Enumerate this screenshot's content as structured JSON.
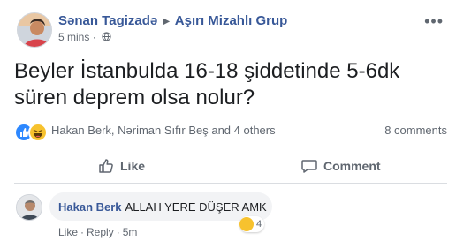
{
  "post": {
    "author": "Sənan Tagizadə",
    "group": "Aşırı Mizahlı Grup",
    "timestamp": "5 mins",
    "separator": "·",
    "text": "Beyler İstanbulda 16-18 şiddetinde 5-6dk süren deprem olsa nolur?",
    "more_icon": "more-horizontal-icon"
  },
  "reactions": {
    "icons": [
      "like-reaction-icon",
      "haha-reaction-icon"
    ],
    "summary": "Hakan Berk, Nəriman Sıfır Beş and 4 others",
    "comment_count": "8 comments"
  },
  "actions": {
    "like_label": "Like",
    "comment_label": "Comment"
  },
  "comment": {
    "author": "Hakan Berk",
    "text": "ALLAH YERE DÜŞER AMK",
    "reaction_count": "4",
    "like_label": "Like",
    "reply_label": "Reply",
    "separator": "·",
    "timestamp": "5m"
  },
  "colors": {
    "link_blue": "#385898",
    "like_blue": "#2d88ff",
    "haha_yellow": "#f7c22e",
    "muted": "#606770"
  }
}
